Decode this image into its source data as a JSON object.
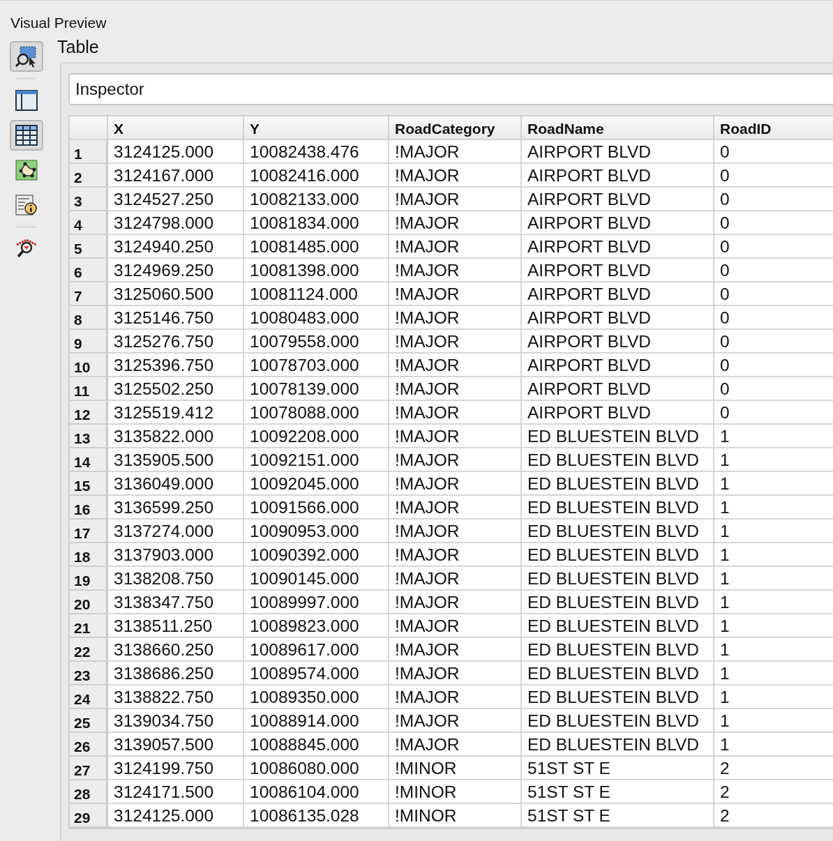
{
  "panel": {
    "title": "Visual Preview"
  },
  "tools": [
    {
      "kind": "zoom-select",
      "selected": true
    },
    {
      "kind": "layout",
      "selected": false
    },
    {
      "kind": "table",
      "selected": true
    },
    {
      "kind": "graph",
      "selected": false
    },
    {
      "kind": "info",
      "selected": false
    },
    {
      "kind": "inspect",
      "selected": false
    }
  ],
  "view": {
    "title": "Table",
    "inspector": {
      "value": "Inspector"
    }
  },
  "table": {
    "columns": [
      "X",
      "Y",
      "RoadCategory",
      "RoadName",
      "RoadID"
    ],
    "rows": [
      {
        "num": "1",
        "cells": [
          "3124125.000",
          "10082438.476",
          "!MAJOR",
          "AIRPORT BLVD",
          "0"
        ]
      },
      {
        "num": "2",
        "cells": [
          "3124167.000",
          "10082416.000",
          "!MAJOR",
          "AIRPORT BLVD",
          "0"
        ]
      },
      {
        "num": "3",
        "cells": [
          "3124527.250",
          "10082133.000",
          "!MAJOR",
          "AIRPORT BLVD",
          "0"
        ]
      },
      {
        "num": "4",
        "cells": [
          "3124798.000",
          "10081834.000",
          "!MAJOR",
          "AIRPORT BLVD",
          "0"
        ]
      },
      {
        "num": "5",
        "cells": [
          "3124940.250",
          "10081485.000",
          "!MAJOR",
          "AIRPORT BLVD",
          "0"
        ]
      },
      {
        "num": "6",
        "cells": [
          "3124969.250",
          "10081398.000",
          "!MAJOR",
          "AIRPORT BLVD",
          "0"
        ]
      },
      {
        "num": "7",
        "cells": [
          "3125060.500",
          "10081124.000",
          "!MAJOR",
          "AIRPORT BLVD",
          "0"
        ]
      },
      {
        "num": "8",
        "cells": [
          "3125146.750",
          "10080483.000",
          "!MAJOR",
          "AIRPORT BLVD",
          "0"
        ]
      },
      {
        "num": "9",
        "cells": [
          "3125276.750",
          "10079558.000",
          "!MAJOR",
          "AIRPORT BLVD",
          "0"
        ]
      },
      {
        "num": "10",
        "cells": [
          "3125396.750",
          "10078703.000",
          "!MAJOR",
          "AIRPORT BLVD",
          "0"
        ]
      },
      {
        "num": "11",
        "cells": [
          "3125502.250",
          "10078139.000",
          "!MAJOR",
          "AIRPORT BLVD",
          "0"
        ]
      },
      {
        "num": "12",
        "cells": [
          "3125519.412",
          "10078088.000",
          "!MAJOR",
          "AIRPORT BLVD",
          "0"
        ]
      },
      {
        "num": "13",
        "cells": [
          "3135822.000",
          "10092208.000",
          "!MAJOR",
          "ED BLUESTEIN BLVD",
          "1"
        ]
      },
      {
        "num": "14",
        "cells": [
          "3135905.500",
          "10092151.000",
          "!MAJOR",
          "ED BLUESTEIN BLVD",
          "1"
        ]
      },
      {
        "num": "15",
        "cells": [
          "3136049.000",
          "10092045.000",
          "!MAJOR",
          "ED BLUESTEIN BLVD",
          "1"
        ]
      },
      {
        "num": "16",
        "cells": [
          "3136599.250",
          "10091566.000",
          "!MAJOR",
          "ED BLUESTEIN BLVD",
          "1"
        ]
      },
      {
        "num": "17",
        "cells": [
          "3137274.000",
          "10090953.000",
          "!MAJOR",
          "ED BLUESTEIN BLVD",
          "1"
        ]
      },
      {
        "num": "18",
        "cells": [
          "3137903.000",
          "10090392.000",
          "!MAJOR",
          "ED BLUESTEIN BLVD",
          "1"
        ]
      },
      {
        "num": "19",
        "cells": [
          "3138208.750",
          "10090145.000",
          "!MAJOR",
          "ED BLUESTEIN BLVD",
          "1"
        ]
      },
      {
        "num": "20",
        "cells": [
          "3138347.750",
          "10089997.000",
          "!MAJOR",
          "ED BLUESTEIN BLVD",
          "1"
        ]
      },
      {
        "num": "21",
        "cells": [
          "3138511.250",
          "10089823.000",
          "!MAJOR",
          "ED BLUESTEIN BLVD",
          "1"
        ]
      },
      {
        "num": "22",
        "cells": [
          "3138660.250",
          "10089617.000",
          "!MAJOR",
          "ED BLUESTEIN BLVD",
          "1"
        ]
      },
      {
        "num": "23",
        "cells": [
          "3138686.250",
          "10089574.000",
          "!MAJOR",
          "ED BLUESTEIN BLVD",
          "1"
        ]
      },
      {
        "num": "24",
        "cells": [
          "3138822.750",
          "10089350.000",
          "!MAJOR",
          "ED BLUESTEIN BLVD",
          "1"
        ]
      },
      {
        "num": "25",
        "cells": [
          "3139034.750",
          "10088914.000",
          "!MAJOR",
          "ED BLUESTEIN BLVD",
          "1"
        ]
      },
      {
        "num": "26",
        "cells": [
          "3139057.500",
          "10088845.000",
          "!MAJOR",
          "ED BLUESTEIN BLVD",
          "1"
        ]
      },
      {
        "num": "27",
        "cells": [
          "3124199.750",
          "10086080.000",
          "!MINOR",
          "51ST ST E",
          "2"
        ]
      },
      {
        "num": "28",
        "cells": [
          "3124171.500",
          "10086104.000",
          "!MINOR",
          "51ST ST E",
          "2"
        ]
      },
      {
        "num": "29",
        "cells": [
          "3124125.000",
          "10086135.028",
          "!MINOR",
          "51ST ST E",
          "2"
        ]
      }
    ]
  }
}
